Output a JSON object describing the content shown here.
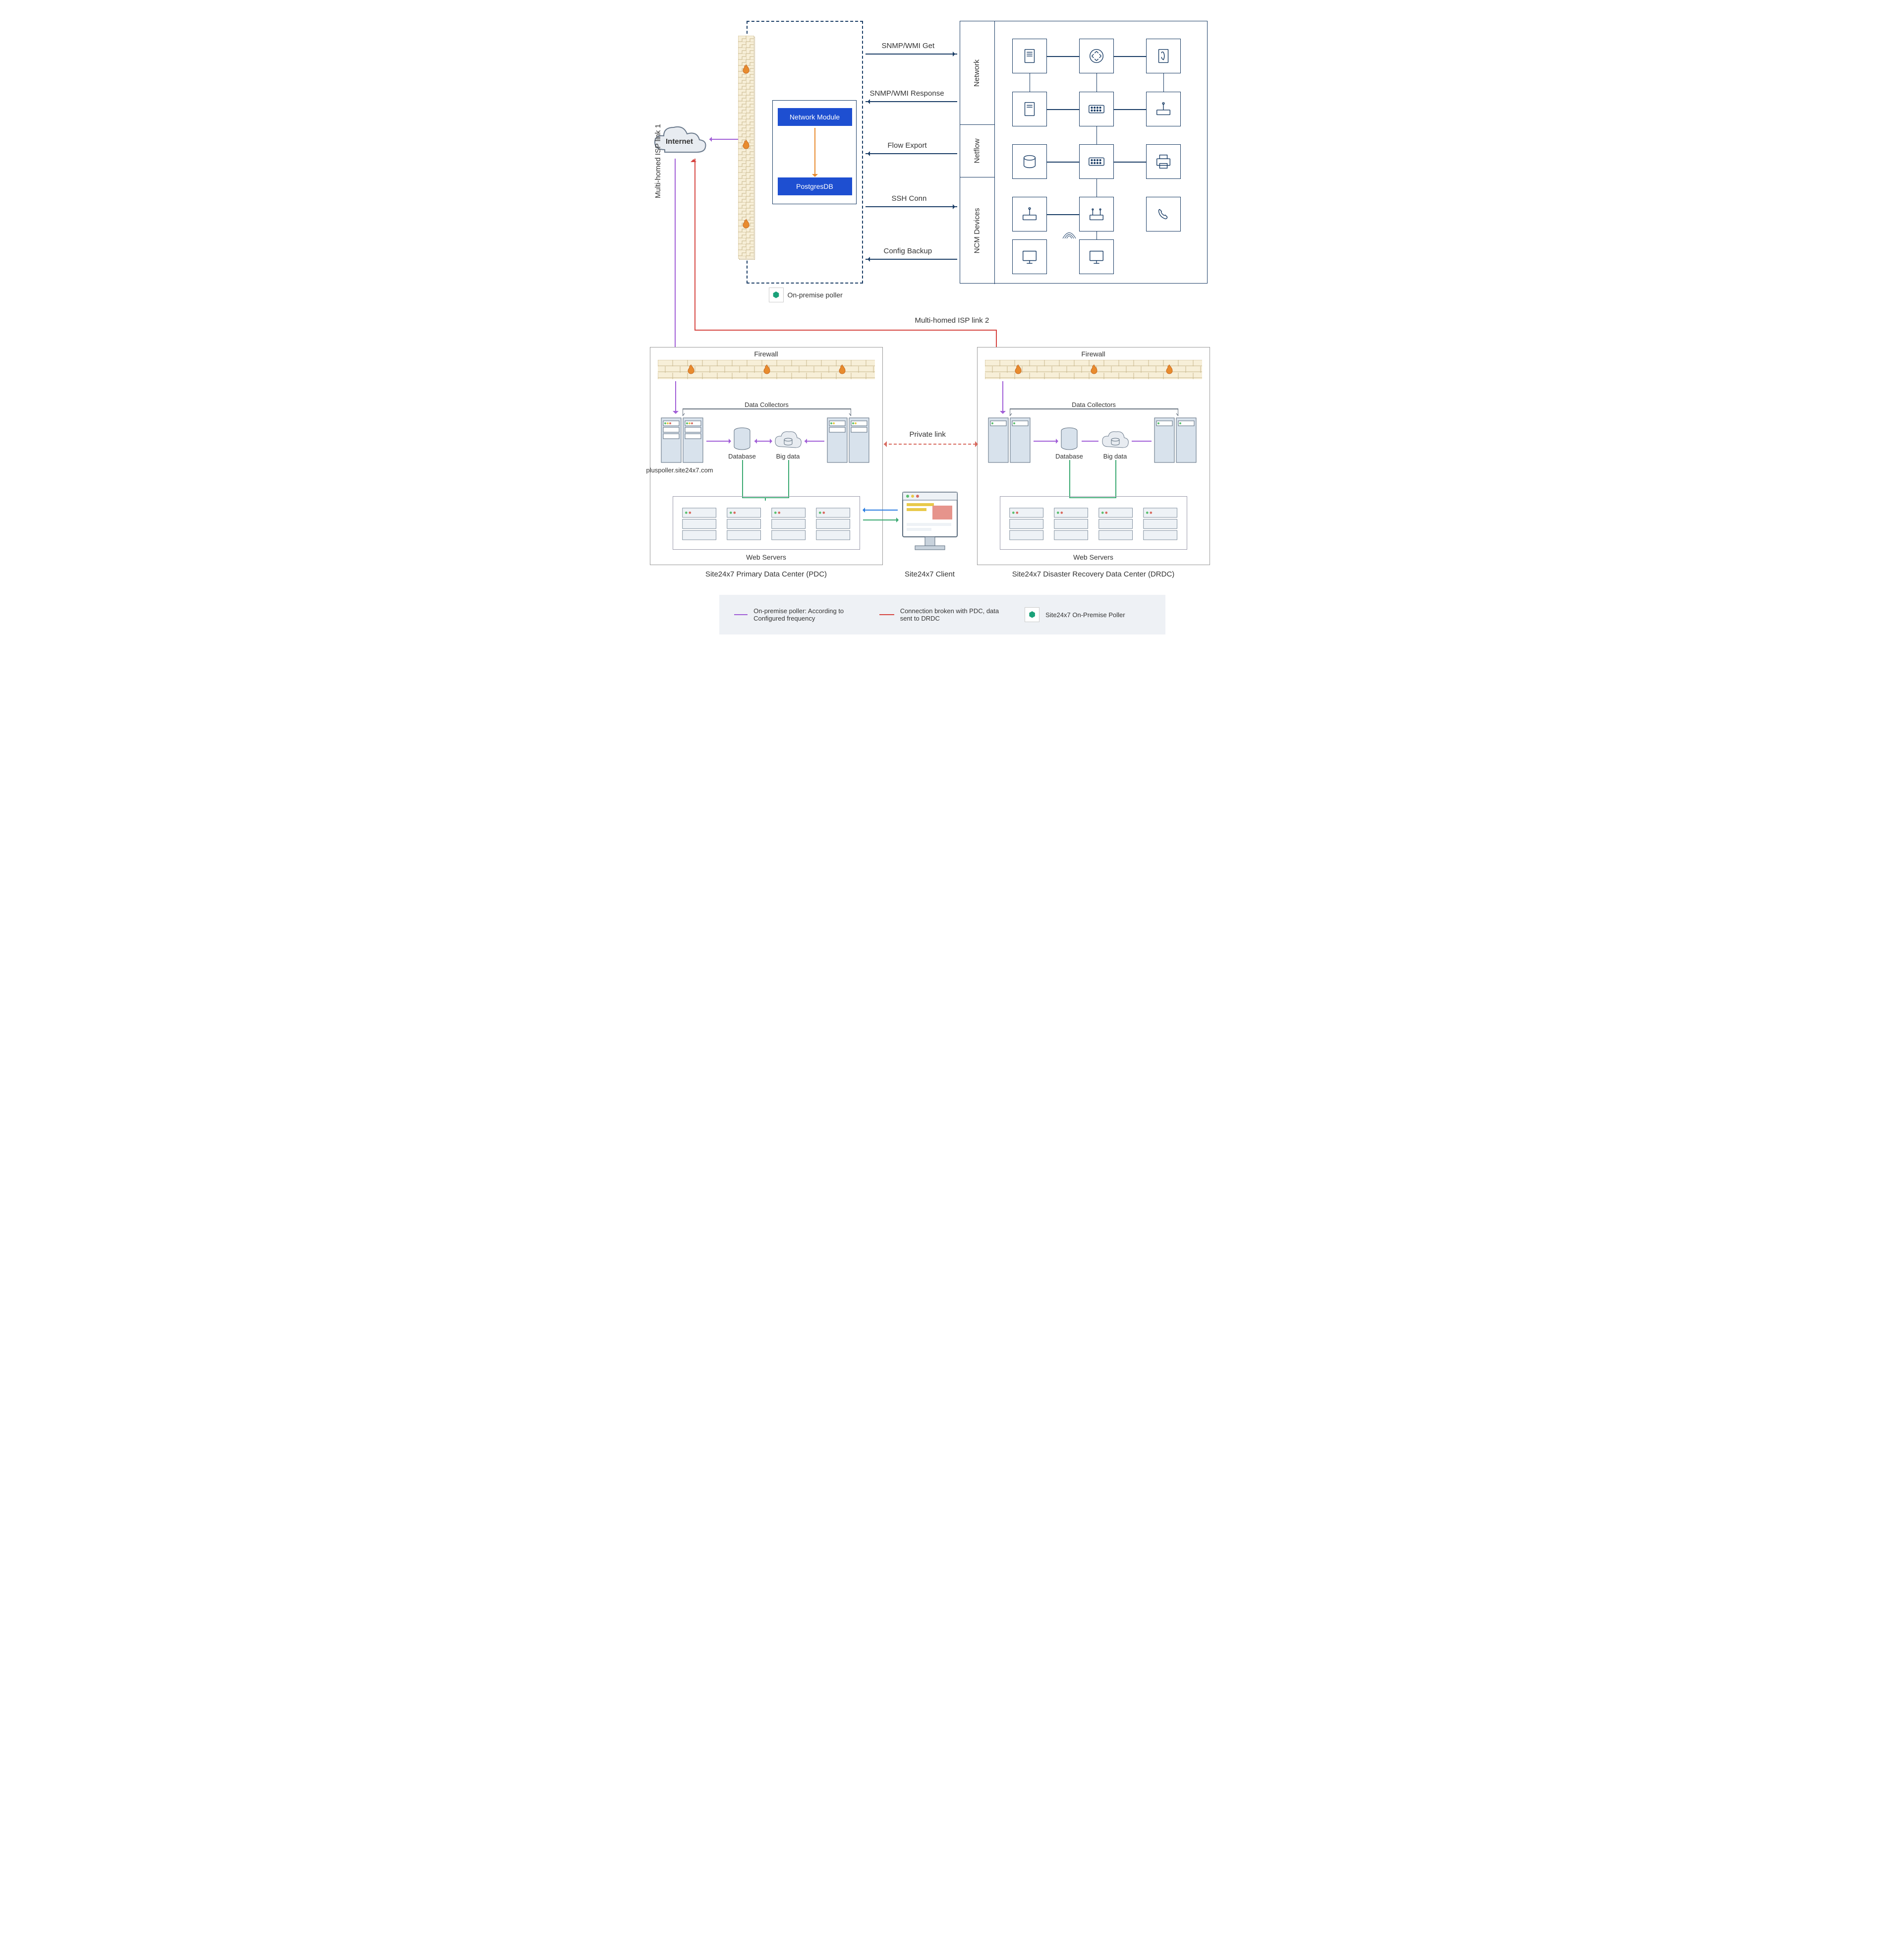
{
  "cloud": {
    "label": "Internet"
  },
  "poller": {
    "tag": "On-premise poller",
    "module": "Network Module",
    "db": "PostgresDB"
  },
  "flows": {
    "f1": "SNMP/WMI Get",
    "f2": "SNMP/WMI Response",
    "f3": "Flow Export",
    "f4": "SSH Conn",
    "f5": "Config Backup"
  },
  "device_cats": {
    "c1": "Network",
    "c2": "Netflow",
    "c3": "NCM Devices"
  },
  "isp": {
    "link1": "Multi-homed ISP link 1",
    "link2": "Multi-homed ISP link 2"
  },
  "dc": {
    "firewall": "Firewall",
    "collectors": "Data Collectors",
    "database": "Database",
    "bigdata": "Big data",
    "webservers": "Web Servers",
    "poller_url": "pluspoller.site24x7.com",
    "private_link": "Private link",
    "pdc_caption": "Site24x7 Primary Data Center (PDC)",
    "drdc_caption": "Site24x7 Disaster Recovery Data Center (DRDC)",
    "client_caption": "Site24x7 Client"
  },
  "legend": {
    "l1": "On-premise poller: According to Configured frequency",
    "l2": "Connection broken with PDC, data sent to DRDC",
    "l3": "Site24x7 On-Premise Poller"
  }
}
